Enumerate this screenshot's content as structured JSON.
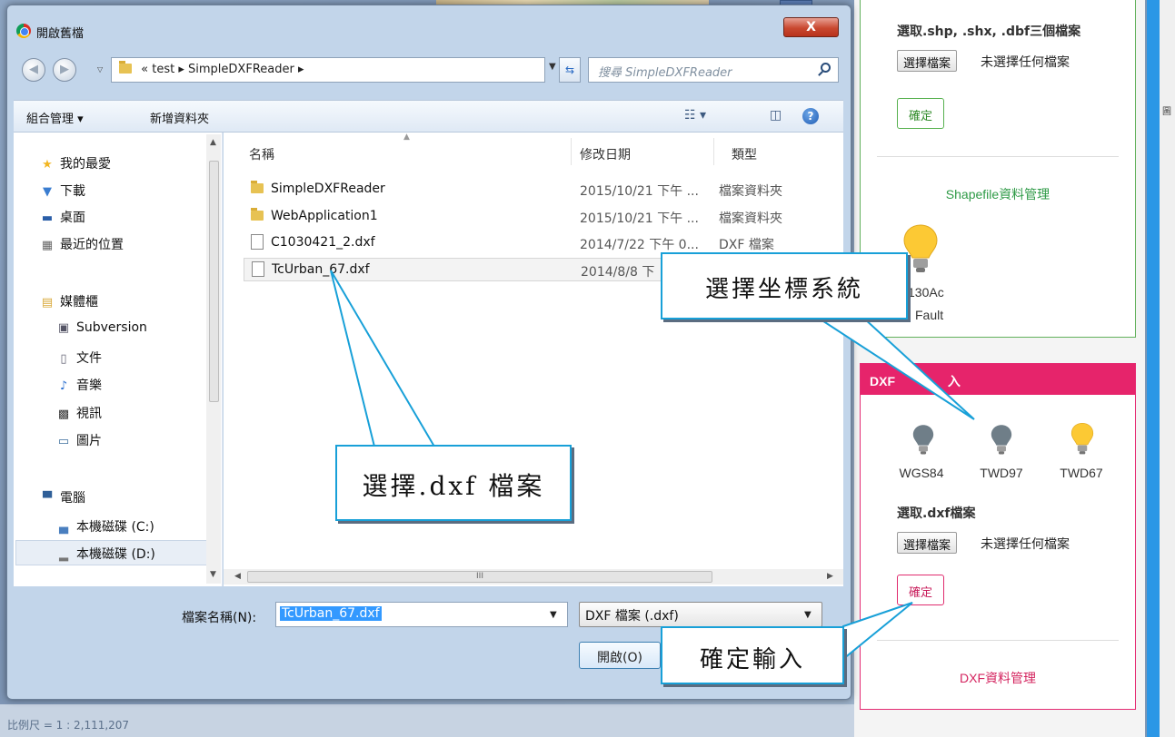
{
  "dialog": {
    "title": "開啟舊檔",
    "close_label": "X",
    "address": {
      "prefix": "«",
      "crumbs": [
        "test",
        "SimpleDXFReader"
      ]
    },
    "search_placeholder": "搜尋 SimpleDXFReader",
    "toolbar": {
      "organize": "組合管理 ▾",
      "new_folder": "新增資料夾"
    },
    "nav": {
      "favorites": "我的最愛",
      "downloads": "下載",
      "desktop": "桌面",
      "recent": "最近的位置",
      "libraries": "媒體櫃",
      "subversion": "Subversion",
      "documents": "文件",
      "music": "音樂",
      "videos": "視訊",
      "pictures": "圖片",
      "computer": "電腦",
      "drive_c": "本機磁碟 (C:)",
      "drive_d": "本機磁碟 (D:)"
    },
    "columns": {
      "name": "名稱",
      "modified": "修改日期",
      "type": "類型"
    },
    "files": [
      {
        "name": "SimpleDXFReader",
        "date": "2015/10/21 下午 ...",
        "type": "檔案資料夾",
        "icon": "folder-icon"
      },
      {
        "name": "WebApplication1",
        "date": "2015/10/21 下午 ...",
        "type": "檔案資料夾",
        "icon": "folder-icon"
      },
      {
        "name": "C1030421_2.dxf",
        "date": "2014/7/22 下午 0...",
        "type": "DXF 檔案",
        "icon": "document-icon"
      },
      {
        "name": "TcUrban_67.dxf",
        "date": "2014/8/8 下",
        "type": "",
        "icon": "document-icon"
      }
    ],
    "hscroll_grip": "III",
    "filename_label": "檔案名稱(N):",
    "filename_value": "TcUrban_67.dxf",
    "filetype_value": "DXF 檔案 (.dxf)",
    "open_label": "開啟(O)"
  },
  "map": {
    "scale_text": "比例尺 = 1 : 2,111,207"
  },
  "side_panel": {
    "edge_char": "圖",
    "shp": {
      "select_label": "選取.shp, .shx, .dbf三個檔案",
      "choose_file": "選擇檔案",
      "no_file": "未選擇任何檔案",
      "ok": "確定",
      "manage": "Shapefile資料管理",
      "partial_1": "130Ac",
      "partial_2": "Fault"
    },
    "dxf": {
      "header": "DXF",
      "header_tail": "入",
      "bulbs": [
        "WGS84",
        "TWD97",
        "TWD67"
      ],
      "select_label": "選取.dxf檔案",
      "choose_file": "選擇檔案",
      "no_file": "未選擇任何檔案",
      "ok": "確定",
      "manage": "DXF資料管理"
    }
  },
  "callouts": {
    "coord": "選擇坐標系統",
    "dxf_file": "選擇.dxf 檔案",
    "confirm": "確定輸入"
  },
  "colors": {
    "shp_accent": "#57b14f",
    "dxf_accent": "#e6246b",
    "callout_border": "#18a0d8"
  }
}
